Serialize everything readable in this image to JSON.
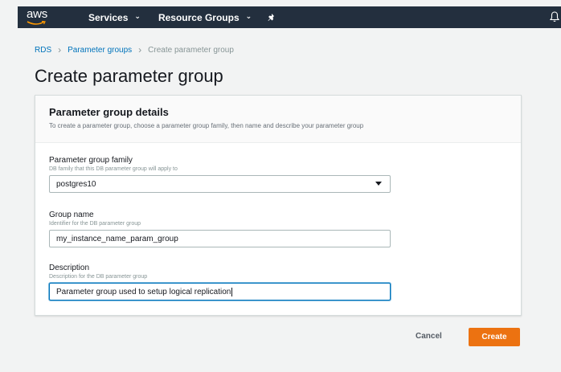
{
  "topnav": {
    "logo": "aws",
    "services_label": "Services",
    "resource_groups_label": "Resource Groups"
  },
  "breadcrumb": {
    "items": [
      "RDS",
      "Parameter groups"
    ],
    "current": "Create parameter group"
  },
  "page": {
    "title": "Create parameter group"
  },
  "card": {
    "title": "Parameter group details",
    "description": "To create a parameter group, choose a parameter group family, then name and describe your parameter group"
  },
  "fields": {
    "family": {
      "label": "Parameter group family",
      "hint": "DB family that this DB parameter group will apply to",
      "value": "postgres10"
    },
    "group_name": {
      "label": "Group name",
      "hint": "Identifier for the DB parameter group",
      "value": "my_instance_name_param_group"
    },
    "description": {
      "label": "Description",
      "hint": "Description for the DB parameter group",
      "value": "Parameter group used to setup logical replication"
    }
  },
  "actions": {
    "cancel_label": "Cancel",
    "create_label": "Create"
  },
  "colors": {
    "nav_bg": "#232f3e",
    "link": "#0073bb",
    "primary_button": "#ec7211",
    "focus_border": "#0073bb"
  }
}
